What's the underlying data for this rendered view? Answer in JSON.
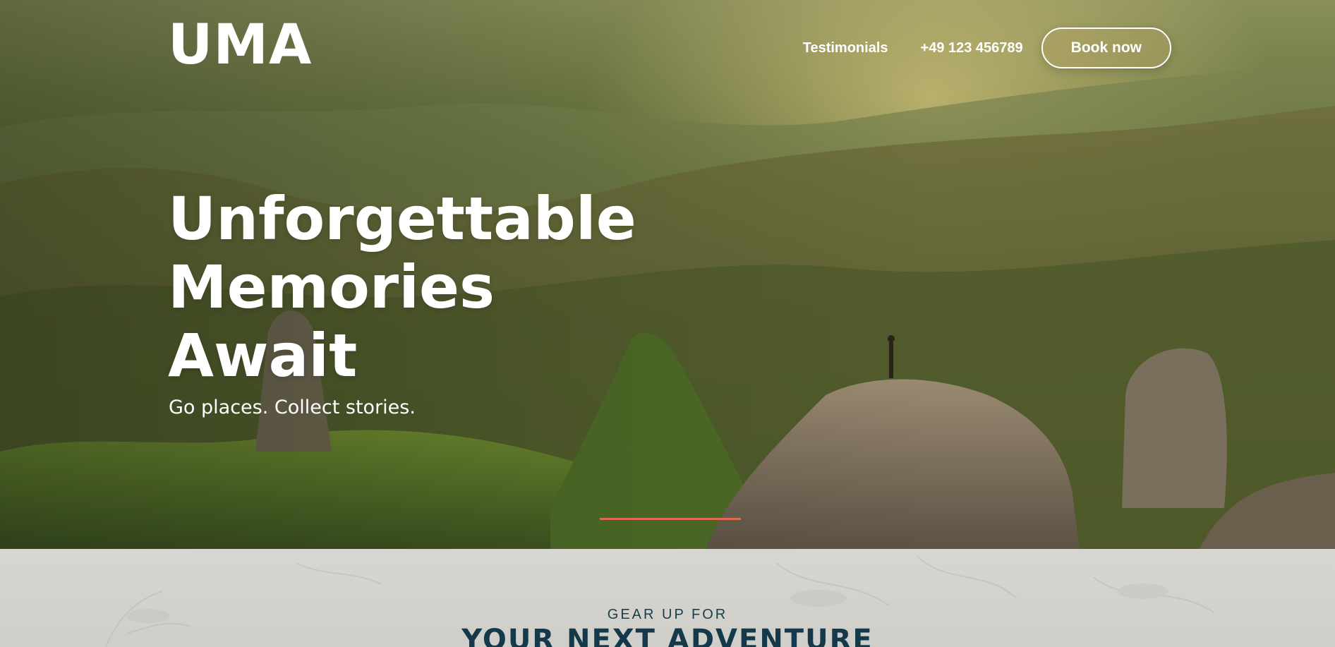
{
  "brand": {
    "logo_text": "UMA"
  },
  "nav": {
    "links": [
      {
        "label": "Testimonials"
      },
      {
        "label": "+49 123 456789"
      }
    ],
    "cta_label": "Book now"
  },
  "hero": {
    "headline_lines": [
      "Unforgettable",
      "Memories",
      "Await"
    ],
    "tagline": "Go places. Collect stories.",
    "accent_color": "#e0694f"
  },
  "section": {
    "eyebrow": "GEAR UP FOR",
    "title": "YOUR NEXT ADVENTURE",
    "title_color": "#13394a"
  }
}
